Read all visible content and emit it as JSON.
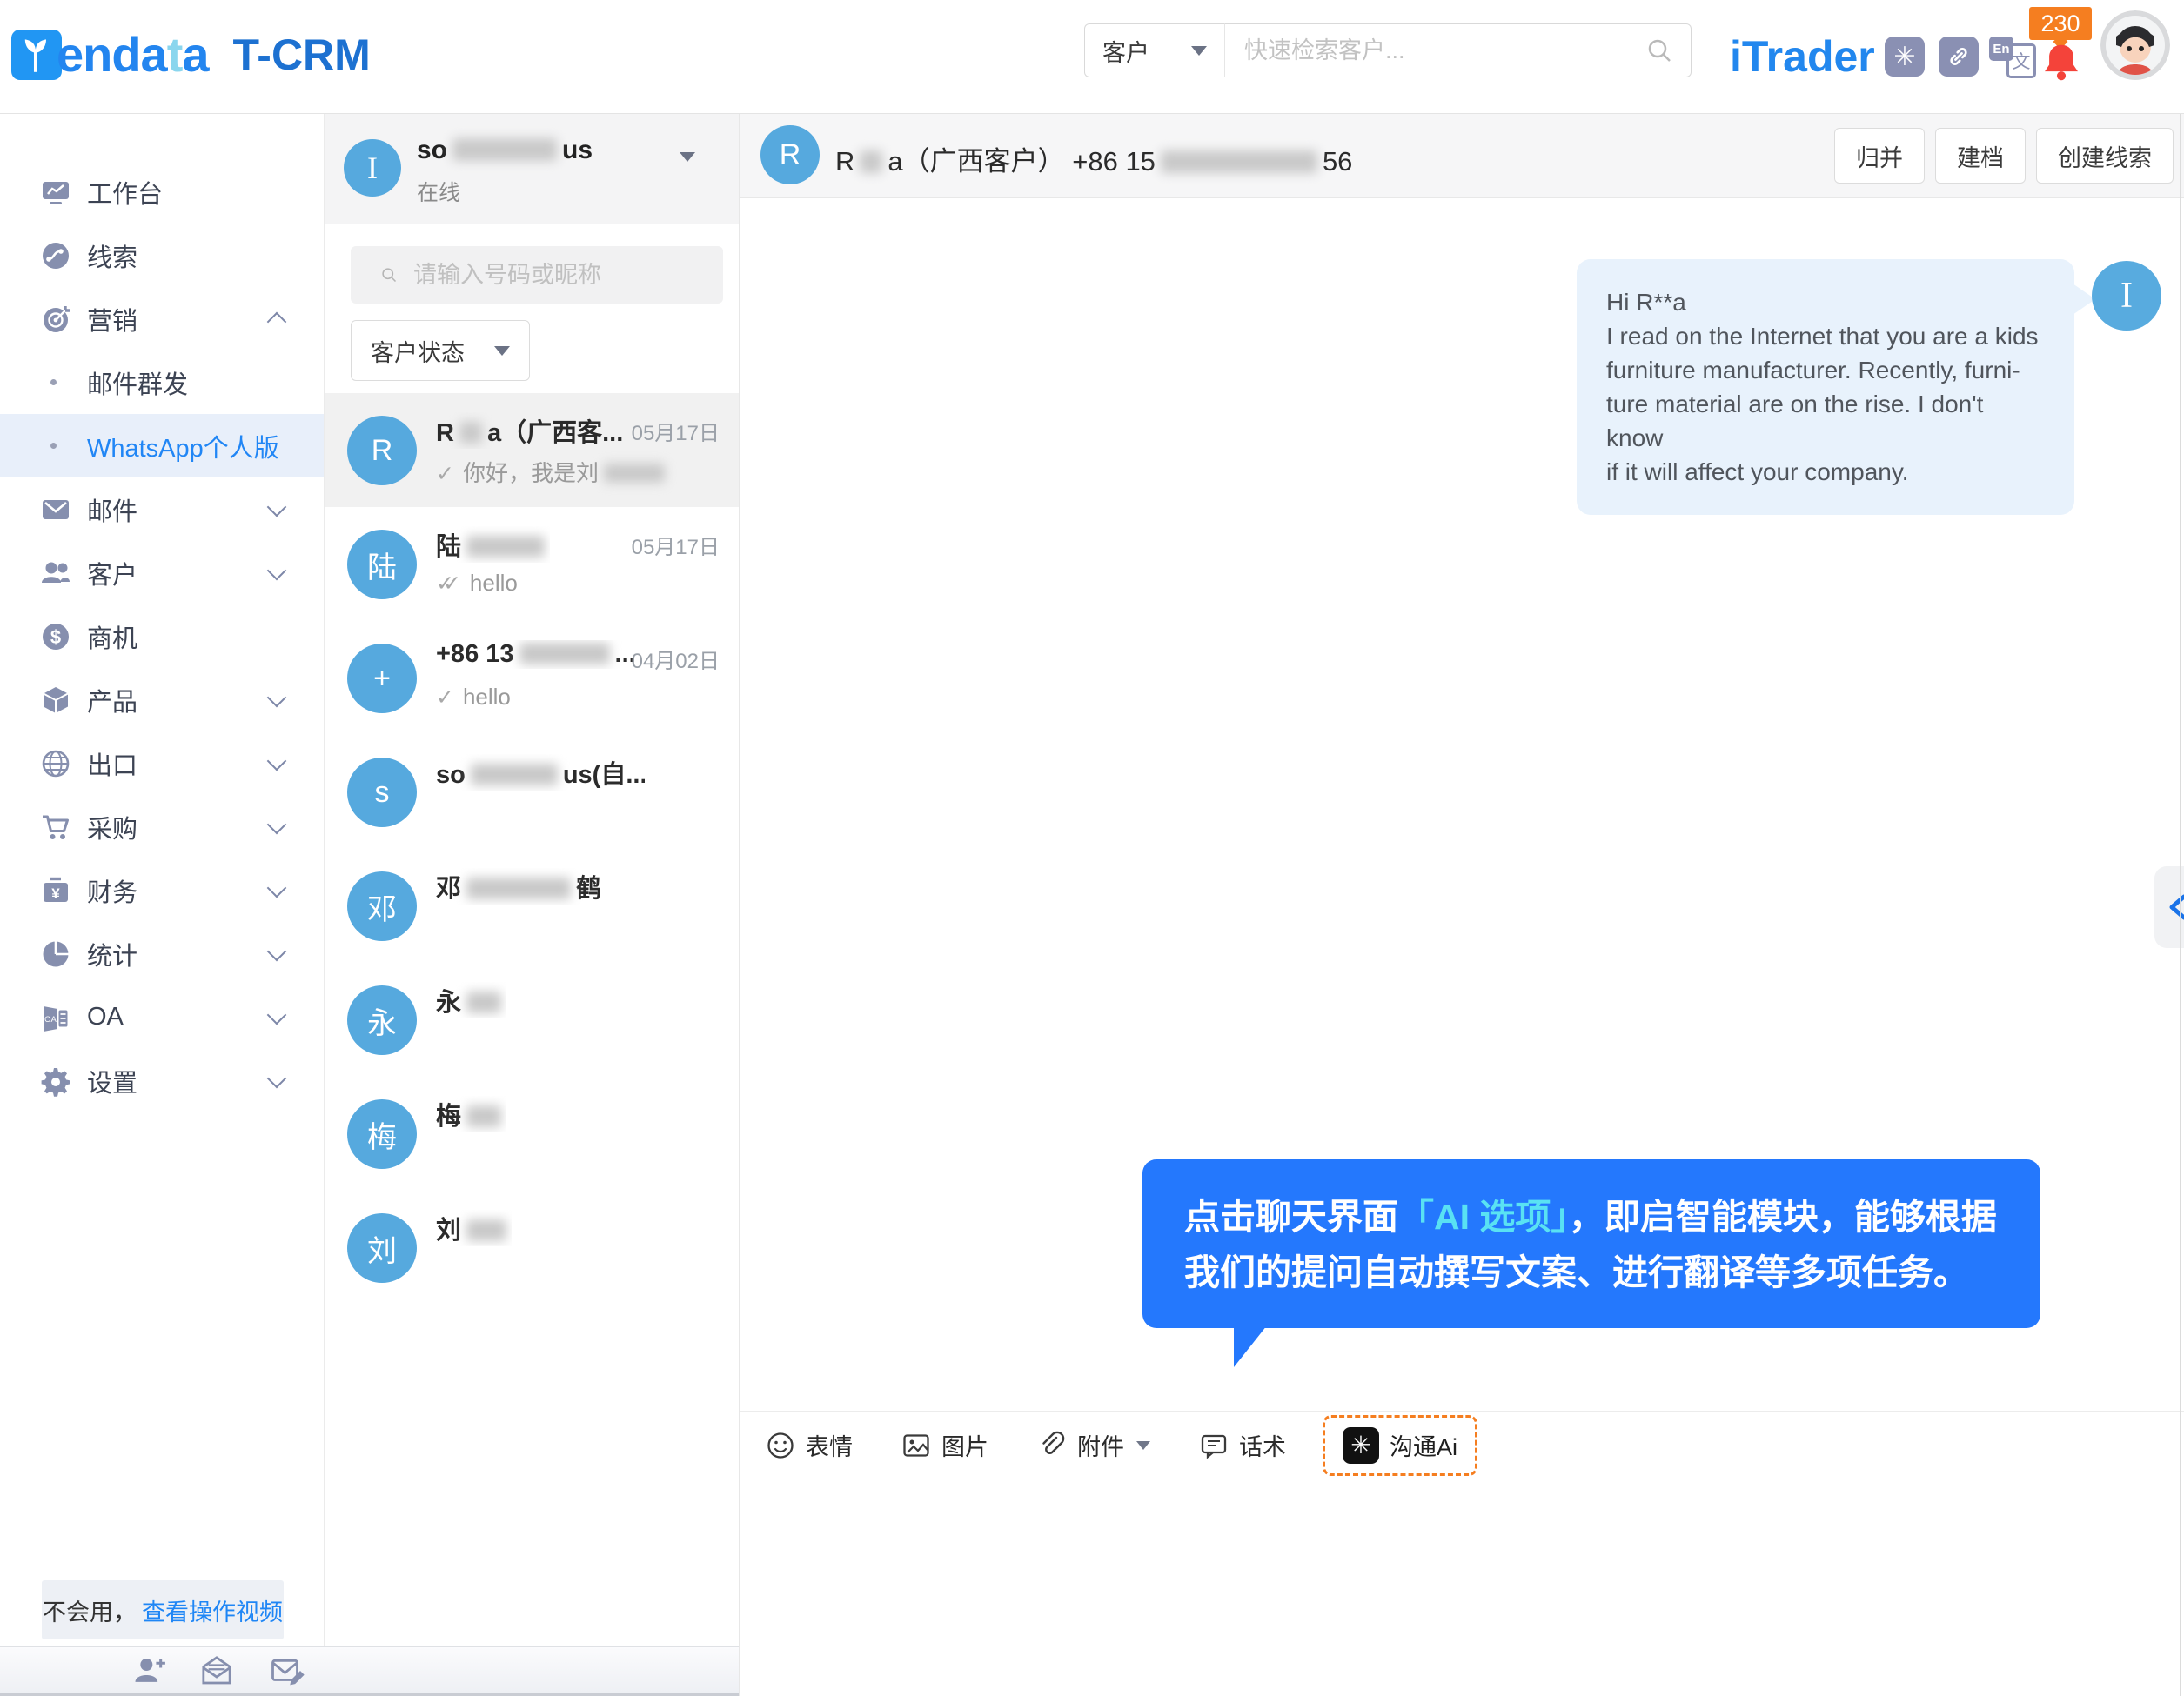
{
  "topbar": {
    "brand": {
      "wordmark_prefix": "enda",
      "wordmark_t": "t",
      "wordmark_suffix": "a",
      "product": "T-CRM"
    },
    "search": {
      "category": "客户",
      "placeholder": "快速检索客户..."
    },
    "itrader": "iTrader",
    "notification_count": "230"
  },
  "sidebar": {
    "items": [
      {
        "label": "工作台",
        "icon": "workbench-icon"
      },
      {
        "label": "线索",
        "icon": "leads-icon"
      },
      {
        "label": "营销",
        "icon": "marketing-icon",
        "chevron": "up"
      },
      {
        "label": "邮件群发",
        "sub": true
      },
      {
        "label": "WhatsApp个人版",
        "sub": true,
        "active": true
      },
      {
        "label": "邮件",
        "icon": "mail-icon",
        "chevron": "down"
      },
      {
        "label": "客户",
        "icon": "customers-icon",
        "chevron": "down"
      },
      {
        "label": "商机",
        "icon": "opportunity-icon"
      },
      {
        "label": "产品",
        "icon": "product-icon",
        "chevron": "down"
      },
      {
        "label": "出口",
        "icon": "export-icon",
        "chevron": "down"
      },
      {
        "label": "采购",
        "icon": "procurement-icon",
        "chevron": "down"
      },
      {
        "label": "财务",
        "icon": "finance-icon",
        "chevron": "down"
      },
      {
        "label": "统计",
        "icon": "stats-icon",
        "chevron": "down"
      },
      {
        "label": "OA",
        "icon": "oa-icon",
        "chevron": "down"
      },
      {
        "label": "设置",
        "icon": "settings-icon",
        "chevron": "down"
      }
    ],
    "help": {
      "text": "不会用，",
      "link": "查看操作视频"
    }
  },
  "chat_list": {
    "profile": {
      "initial": "I",
      "name_parts": [
        "so",
        {
          "blur": 120
        },
        "us"
      ],
      "status": "在线"
    },
    "search_placeholder": "请输入号码或昵称",
    "status_filter": "客户状态",
    "contacts": [
      {
        "initial": "R",
        "name_parts": [
          "R",
          {
            "blur": 26
          },
          "a（广西客..."
        ],
        "date": "05月17日",
        "ticks": 1,
        "message_parts": [
          "你好，我是刘",
          {
            "blur": 70
          }
        ],
        "selected": true
      },
      {
        "initial": "陆",
        "name_parts": [
          "陆",
          {
            "blur": 90
          }
        ],
        "date": "05月17日",
        "ticks": 2,
        "message_parts": [
          "hello"
        ]
      },
      {
        "initial": "+",
        "name_parts": [
          "+86 13",
          {
            "blur": 104
          },
          "..."
        ],
        "date": "04月02日",
        "ticks": 1,
        "message_parts": [
          "hello"
        ]
      },
      {
        "initial": "s",
        "name_parts": [
          "so",
          {
            "blur": 100
          },
          "us(自..."
        ]
      },
      {
        "initial": "邓",
        "name_parts": [
          "邓",
          {
            "blur": 120
          },
          "鹤"
        ]
      },
      {
        "initial": "永",
        "name_parts": [
          "永",
          {
            "blur": 40
          }
        ]
      },
      {
        "initial": "梅",
        "name_parts": [
          "梅",
          {
            "blur": 40
          }
        ]
      },
      {
        "initial": "刘",
        "name_parts": [
          "刘",
          {
            "blur": 46
          }
        ]
      }
    ]
  },
  "chat": {
    "header": {
      "initial": "R",
      "title_parts": [
        "R",
        {
          "blur": 26
        },
        "a（广西客户） +86 15",
        {
          "blur": 180
        },
        "56"
      ],
      "buttons": [
        "归并",
        "建档",
        "创建线索"
      ]
    },
    "message": {
      "avatar_initial": "I",
      "lines": [
        "Hi R**a",
        "I read on the Internet that you are a kids",
        "furniture manufacturer. Recently, furni-",
        "ture material are on the rise. I don't know",
        "if it will affect your company."
      ]
    },
    "tooltip": {
      "line1_pre": "点击聊天界面",
      "line1_highlight": "「AI 选项」",
      "line1_post": "，即启智能模块，能够根据",
      "line2": "我们的提问自动撰写文案、进行翻译等多项任务。"
    },
    "toolbar": [
      {
        "label": "表情",
        "icon": "emoji-icon"
      },
      {
        "label": "图片",
        "icon": "image-icon"
      },
      {
        "label": "附件",
        "icon": "attachment-icon",
        "dropdown": true
      },
      {
        "label": "话术",
        "icon": "scripts-icon"
      },
      {
        "label": "沟通Ai",
        "icon": "openai-icon",
        "ai": true
      }
    ]
  },
  "bottom_bar": {
    "icons": [
      "add-contact-icon",
      "inbox-icon",
      "compose-icon"
    ]
  },
  "colors": {
    "accent_blue": "#2287ee",
    "tooltip_blue": "#2478fd",
    "tooltip_cyan": "#59e2f3",
    "badge_orange": "#f57e20",
    "bell_red": "#f4433a",
    "avatar_blue": "#56a9de",
    "link_blue": "#2186f5"
  }
}
